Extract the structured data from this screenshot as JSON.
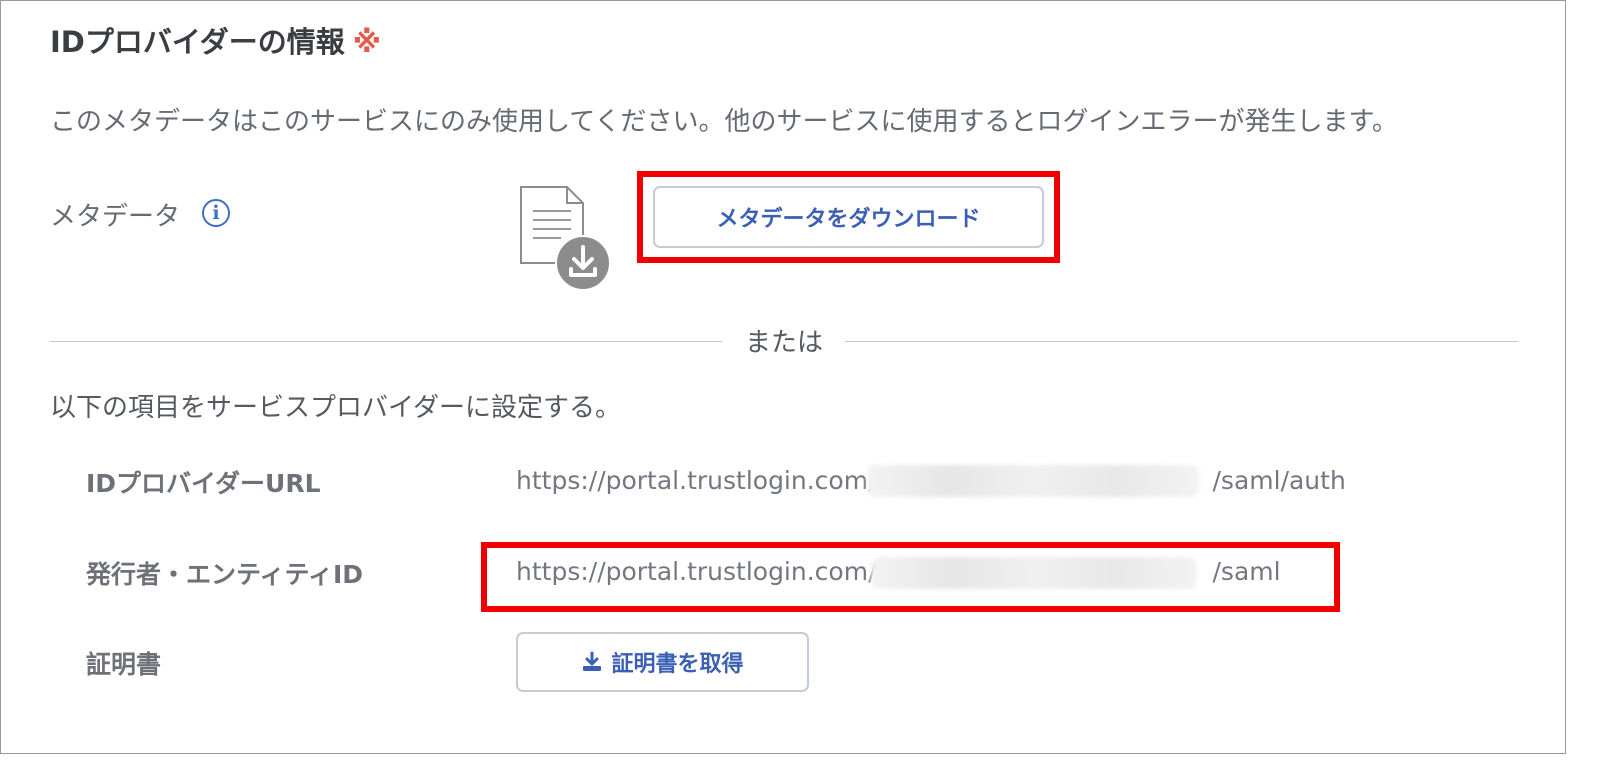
{
  "section": {
    "title": "IDプロバイダーの情報",
    "required_mark": "※",
    "description": "このメタデータはこのサービスにのみ使用してください。他のサービスに使用するとログインエラーが発生します。"
  },
  "metadata": {
    "label": "メタデータ",
    "info_icon_glyph": "i",
    "download_button": "メタデータをダウンロード"
  },
  "divider": {
    "text": "または"
  },
  "settings": {
    "description": "以下の項目をサービスプロバイダーに設定する。",
    "rows": [
      {
        "label": "IDプロバイダーURL",
        "value_prefix": "https://portal.trustlogin.com/",
        "value_suffix": "/saml/auth"
      },
      {
        "label": "発行者・エンティティID",
        "value_prefix": "https://portal.trustlogin.com/",
        "value_suffix": "/saml"
      },
      {
        "label": "証明書",
        "button": "証明書を取得"
      }
    ]
  },
  "colors": {
    "accent": "#3a5fb4",
    "required": "#e25b4b",
    "highlight": "#f00000"
  }
}
